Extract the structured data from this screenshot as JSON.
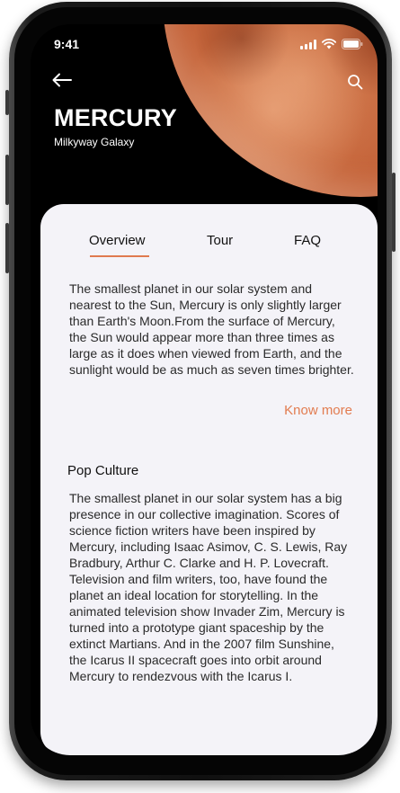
{
  "status_bar": {
    "time": "9:41",
    "icons": [
      "cellular-signal-icon",
      "wifi-icon",
      "battery-icon"
    ]
  },
  "header": {
    "back_icon": "arrow-left-icon",
    "search_icon": "search-icon",
    "title": "MERCURY",
    "subtitle": "Milkyway Galaxy"
  },
  "tabs": [
    {
      "label": "Overview",
      "active": true
    },
    {
      "label": "Tour",
      "active": false
    },
    {
      "label": "FAQ",
      "active": false
    }
  ],
  "overview": {
    "text": "The smallest planet in our solar system and nearest to the Sun, Mercury is only slightly larger than Earth's Moon.From the surface of Mercury, the Sun would appear more than three times as large as it does when viewed from Earth, and the sunlight would be as much as seven times brighter.",
    "link_label": "Know more"
  },
  "pop_culture": {
    "heading": "Pop Culture",
    "text": "The smallest planet in our solar system has a big presence in our collective imagination. Scores of science fiction writers have been inspired by Mercury, including Isaac Asimov, C. S. Lewis, Ray Bradbury, Arthur C. Clarke and H. P. Lovecraft. Television and film writers, too, have found the planet an ideal location for storytelling. In the animated television show Invader Zim, Mercury is turned into a prototype giant spaceship by the extinct Martians. And in the 2007 film Sunshine, the Icarus II spacecraft goes into orbit around Mercury to rendezvous with the Icarus I."
  },
  "colors": {
    "accent": "#e27c50",
    "card_background": "#f4f3f8",
    "screen_background": "#000000",
    "planet": "#c15d33"
  }
}
